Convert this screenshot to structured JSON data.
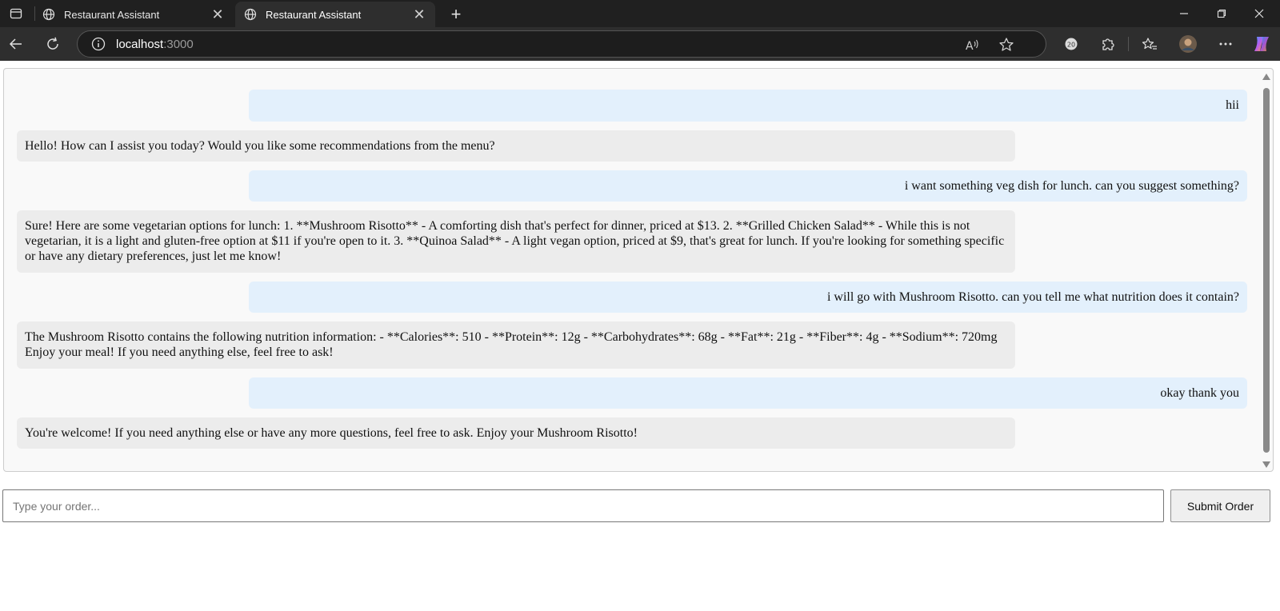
{
  "browser": {
    "tabs": [
      {
        "title": "Restaurant Assistant",
        "active": false
      },
      {
        "title": "Restaurant Assistant",
        "active": true
      }
    ],
    "address": {
      "host": "localhost",
      "port": ":3000"
    },
    "icons": {
      "tab_actions": "tab-actions-icon",
      "globe": "globe-icon",
      "close": "close-icon",
      "new_tab": "plus-icon",
      "back": "back-arrow-icon",
      "reload": "reload-icon",
      "info": "info-icon",
      "read_aloud": "read-aloud-icon",
      "favorite": "star-icon",
      "extension": "puzzle-icon",
      "favorites": "favorites-icon",
      "profile": "avatar-icon",
      "more": "more-icon",
      "copilot": "copilot-icon"
    }
  },
  "chat": {
    "messages": [
      {
        "role": "user",
        "text": "hii"
      },
      {
        "role": "bot",
        "text": "Hello! How can I assist you today? Would you like some recommendations from the menu?"
      },
      {
        "role": "user",
        "text": "i want something veg dish for lunch. can you suggest something?"
      },
      {
        "role": "bot",
        "text": "Sure! Here are some vegetarian options for lunch: 1. **Mushroom Risotto** - A comforting dish that's perfect for dinner, priced at $13. 2. **Grilled Chicken Salad** - While this is not vegetarian, it is a light and gluten-free option at $11 if you're open to it. 3. **Quinoa Salad** - A light vegan option, priced at $9, that's great for lunch. If you're looking for something specific or have any dietary preferences, just let me know!"
      },
      {
        "role": "user",
        "text": "i will go with Mushroom Risotto. can you tell me what nutrition does it contain?"
      },
      {
        "role": "bot",
        "text": "The Mushroom Risotto contains the following nutrition information: - **Calories**: 510 - **Protein**: 12g - **Carbohydrates**: 68g - **Fat**: 21g - **Fiber**: 4g - **Sodium**: 720mg Enjoy your meal! If you need anything else, feel free to ask!"
      },
      {
        "role": "user",
        "text": "okay thank you"
      },
      {
        "role": "bot",
        "text": "You're welcome! If you need anything else or have any more questions, feel free to ask. Enjoy your Mushroom Risotto!"
      }
    ]
  },
  "order": {
    "placeholder": "Type your order...",
    "value": "",
    "submit_label": "Submit Order"
  },
  "colors": {
    "user_bubble": "#e3f0fc",
    "bot_bubble": "#ececec",
    "chrome_bg": "#202020"
  }
}
